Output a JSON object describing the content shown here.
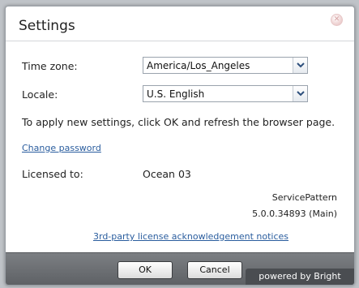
{
  "dialog": {
    "title": "Settings",
    "close_icon": "close-icon"
  },
  "timezone": {
    "label": "Time zone:",
    "value": "America/Los_Angeles"
  },
  "locale": {
    "label": "Locale:",
    "value": "U.S. English"
  },
  "info_text": "To apply new settings, click OK and refresh the browser page.",
  "change_password": "Change password",
  "license": {
    "label": "Licensed to:",
    "value": "Ocean 03"
  },
  "product": {
    "name": "ServicePattern",
    "version": "5.0.0.34893 (Main)"
  },
  "notices_link": "3rd-party license acknowledgement notices",
  "buttons": {
    "ok": "OK",
    "cancel": "Cancel"
  },
  "branding": "powered by Bright Pattern",
  "colors": {
    "link": "#2a5d9e",
    "footer": "#6d7074"
  }
}
